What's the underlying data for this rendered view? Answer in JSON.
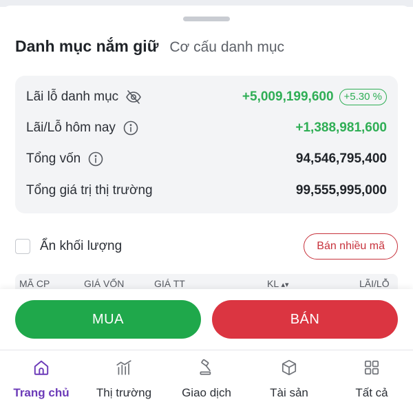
{
  "tabs": {
    "active": "Danh mục nắm giữ",
    "inactive": "Cơ cấu danh mục"
  },
  "summary": {
    "pnl_label": "Lãi lỗ danh mục",
    "pnl_value": "+5,009,199,600",
    "pnl_percent": "+5.30 %",
    "today_label": "Lãi/Lỗ hôm nay",
    "today_value": "+1,388,981,600",
    "capital_label": "Tổng vốn",
    "capital_value": "94,546,795,400",
    "market_label": "Tổng giá trị thị trường",
    "market_value": "99,555,995,000"
  },
  "options": {
    "hide_volume_label": "Ẩn khối lượng",
    "hide_volume_checked": false,
    "sell_multiple_label": "Bán nhiều mã"
  },
  "table_headers": [
    "MÃ CP",
    "GIÁ VỐN",
    "GIÁ TT",
    "KL",
    "LÃI/LỖ"
  ],
  "actions": {
    "buy_label": "MUA",
    "sell_label": "BÁN"
  },
  "nav": [
    {
      "label": "Trang chủ",
      "icon": "home-icon",
      "active": true
    },
    {
      "label": "Thị trường",
      "icon": "market-chart-icon",
      "active": false
    },
    {
      "label": "Giao dịch",
      "icon": "gavel-icon",
      "active": false
    },
    {
      "label": "Tài sản",
      "icon": "cube-icon",
      "active": false
    },
    {
      "label": "Tất cả",
      "icon": "grid-icon",
      "active": false
    }
  ],
  "colors": {
    "positive": "#2fae55",
    "buy": "#1fa84b",
    "sell": "#db3541",
    "accent": "#6b3ab8"
  }
}
